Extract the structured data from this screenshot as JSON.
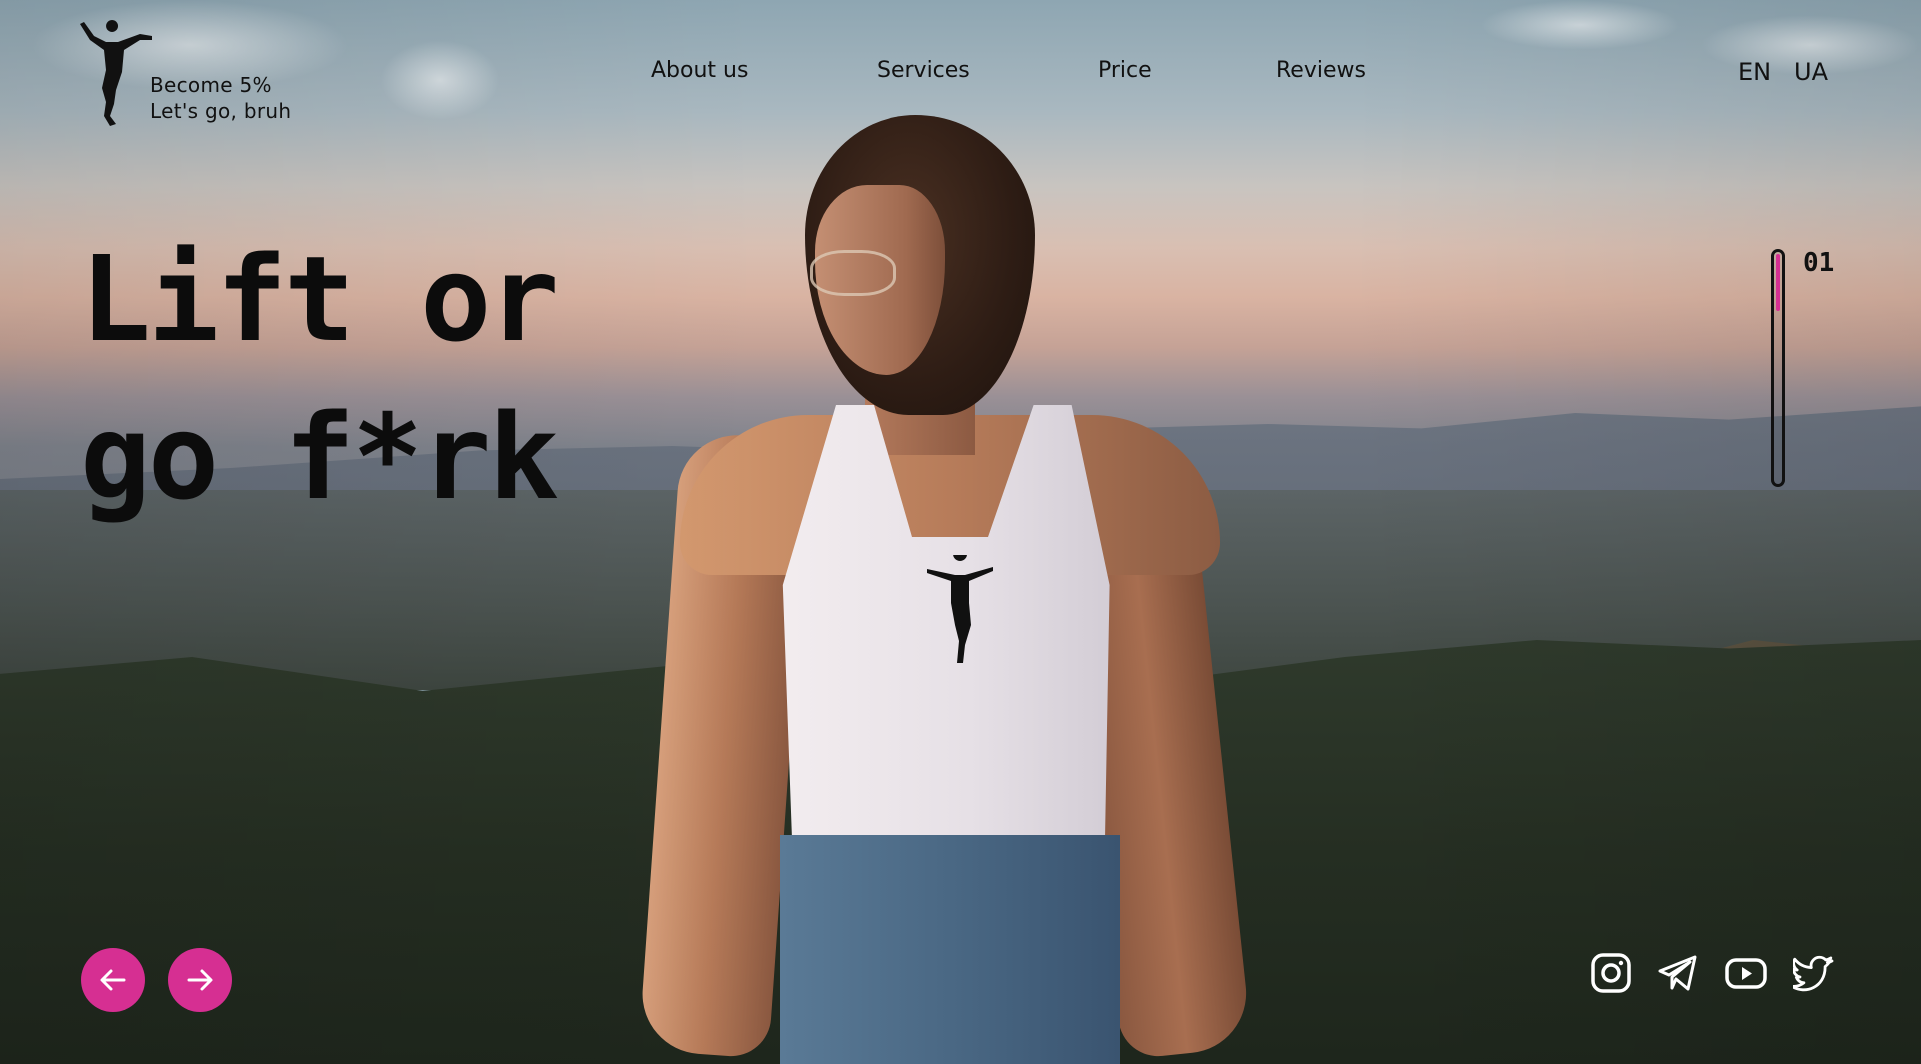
{
  "brand": {
    "line1": "Become 5%",
    "line2": "Let's go, bruh",
    "logo_icon": "dancer-figure-icon"
  },
  "nav": {
    "items": [
      {
        "label": "About us"
      },
      {
        "label": "Services"
      },
      {
        "label": "Price"
      },
      {
        "label": "Reviews"
      }
    ]
  },
  "languages": {
    "en": "EN",
    "ua": "UA"
  },
  "hero": {
    "line1": "Lift or",
    "line2": "go f*rk"
  },
  "slider": {
    "current": "01",
    "progress_fraction": 0.25,
    "accent_color": "#d62f92",
    "prev_icon": "arrow-left-icon",
    "next_icon": "arrow-right-icon"
  },
  "social": [
    {
      "name": "instagram",
      "icon": "instagram-icon"
    },
    {
      "name": "telegram",
      "icon": "telegram-icon"
    },
    {
      "name": "youtube",
      "icon": "youtube-icon"
    },
    {
      "name": "twitter",
      "icon": "twitter-icon"
    }
  ]
}
